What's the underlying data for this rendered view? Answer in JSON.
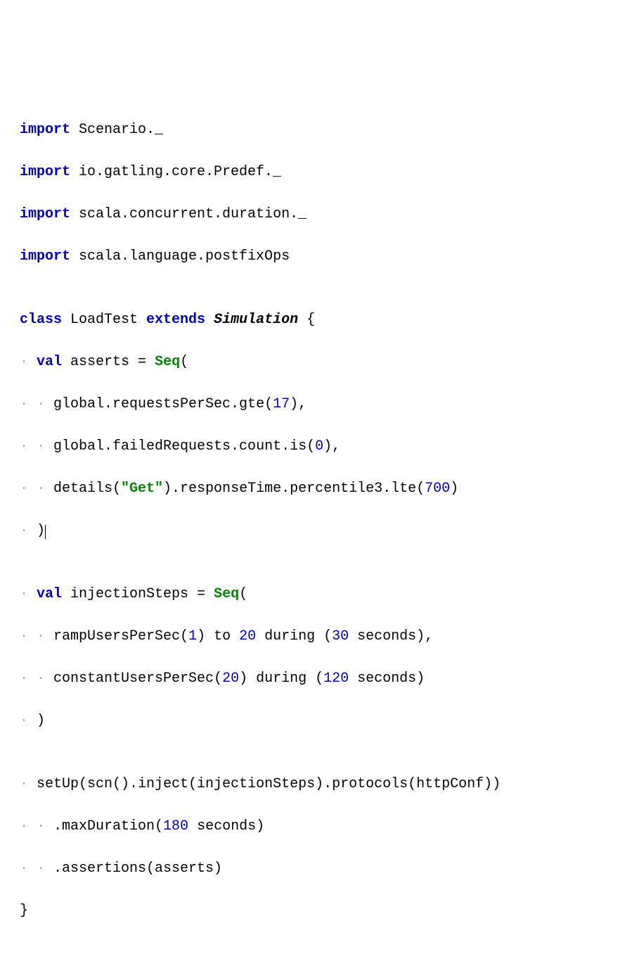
{
  "code": {
    "lines": {
      "l1_kw": "import",
      "l1_rest": " Scenario._",
      "l2_kw": "import",
      "l2_rest": " io.gatling.core.Predef._",
      "l3_kw": "import",
      "l3_rest": " scala.concurrent.duration._",
      "l4_kw": "import",
      "l4_rest": " scala.language.postfixOps",
      "l5_empty": "",
      "l6_class": "class",
      "l6_name": " LoadTest ",
      "l6_extends": "extends",
      "l6_sim": " Simulation ",
      "l6_brace": "{",
      "l7_ws": "  ",
      "l7_val": "val",
      "l7_name": " asserts = ",
      "l7_seq": "Seq",
      "l7_paren": "(",
      "l8_ws": "    ",
      "l8_txt": "global.requestsPerSec.gte(",
      "l8_num": "17",
      "l8_end": "),",
      "l9_ws": "    ",
      "l9_txt": "global.failedRequests.count.is(",
      "l9_num": "0",
      "l9_end": "),",
      "l10_ws": "    ",
      "l10_txt1": "details(",
      "l10_str": "\"Get\"",
      "l10_txt2": ").responseTime.percentile3.lte(",
      "l10_num": "700",
      "l10_end": ")",
      "l11_ws": "  ",
      "l11_txt": ")",
      "l12_empty": "",
      "l13_ws": "  ",
      "l13_val": "val",
      "l13_name": " injectionSteps = ",
      "l13_seq": "Seq",
      "l13_paren": "(",
      "l14_ws": "    ",
      "l14_txt1": "rampUsersPerSec(",
      "l14_num1": "1",
      "l14_txt2": ") to ",
      "l14_num2": "20",
      "l14_txt3": " during (",
      "l14_num3": "30",
      "l14_txt4": " seconds),",
      "l15_ws": "    ",
      "l15_txt1": "constantUsersPerSec(",
      "l15_num1": "20",
      "l15_txt2": ") during (",
      "l15_num2": "120",
      "l15_txt3": " seconds)",
      "l16_ws": "  ",
      "l16_txt": ")",
      "l17_empty": "",
      "l18_ws": "  ",
      "l18_txt": "setUp(scn().inject(injectionSteps).protocols(httpConf))",
      "l19_ws": "    ",
      "l19_txt1": ".maxDuration(",
      "l19_num": "180",
      "l19_txt2": " seconds)",
      "l20_ws": "    ",
      "l20_txt": ".assertions(asserts)",
      "l21_txt": "}"
    }
  }
}
